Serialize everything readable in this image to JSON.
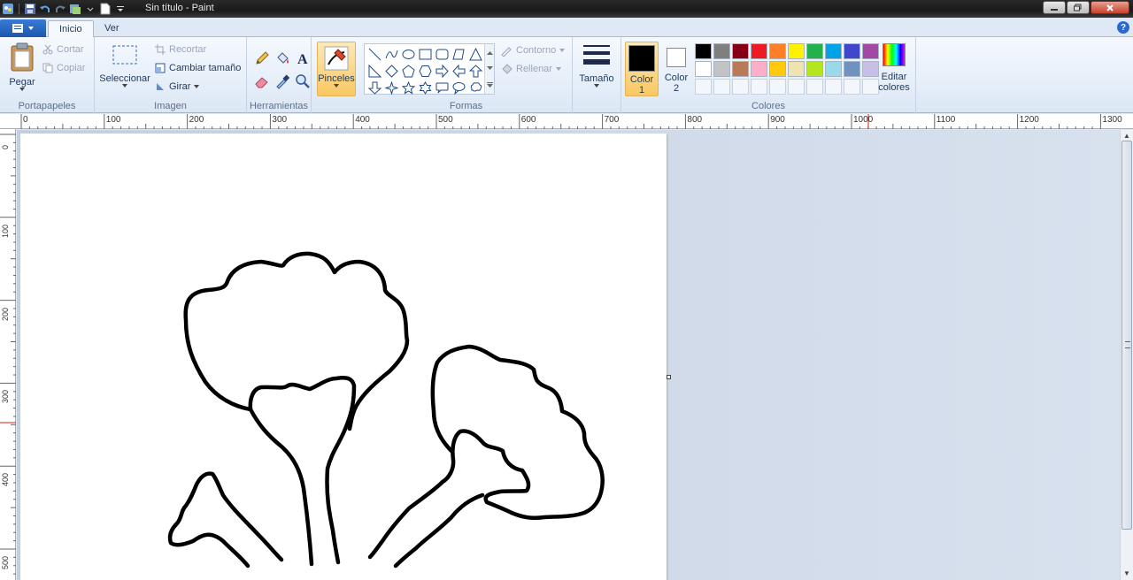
{
  "window": {
    "title": "Sin título - Paint"
  },
  "tabs": [
    {
      "label": "Inicio"
    },
    {
      "label": "Ver"
    }
  ],
  "help": {
    "label": "?"
  },
  "ribbon": {
    "portapapeles": {
      "label": "Portapapeles",
      "pegar": "Pegar",
      "cortar": "Cortar",
      "copiar": "Copiar"
    },
    "imagen": {
      "label": "Imagen",
      "seleccionar": "Seleccionar",
      "recortar": "Recortar",
      "cambiar_tamano": "Cambiar tamaño",
      "girar": "Girar"
    },
    "herramientas": {
      "label": "Herramientas"
    },
    "pinceles": {
      "label": "Pinceles"
    },
    "formas": {
      "label": "Formas",
      "contorno": "Contorno",
      "rellenar": "Rellenar"
    },
    "tamano": {
      "label": "Tamaño"
    },
    "colores": {
      "label": "Colores",
      "color1_line1": "Color",
      "color1_line2": "1",
      "color2_line1": "Color",
      "color2_line2": "2",
      "editar_line1": "Editar",
      "editar_line2": "colores",
      "color1_value": "#000000",
      "color2_value": "#ffffff",
      "palette_row1": [
        "#000000",
        "#7f7f7f",
        "#880015",
        "#ed1c24",
        "#ff7f27",
        "#fff200",
        "#22b14c",
        "#00a2e8",
        "#3f48cc",
        "#a349a4"
      ],
      "palette_row2": [
        "#ffffff",
        "#c3c3c3",
        "#b97a57",
        "#ffaec9",
        "#ffc90e",
        "#efe4b0",
        "#b5e61d",
        "#99d9ea",
        "#7092be",
        "#c8bfe7"
      ]
    }
  },
  "ruler": {
    "h_labels": [
      "0",
      "100",
      "200",
      "300",
      "400",
      "500",
      "600",
      "700",
      "800",
      "900",
      "1000",
      "1100",
      "1200",
      "1300"
    ],
    "v_labels": [
      "0",
      "100",
      "200",
      "300",
      "400",
      "500"
    ]
  },
  "icons": {
    "app_menu": "app-menu-icon",
    "save": "save-icon",
    "undo": "undo-icon",
    "redo": "redo-icon",
    "new": "new-file-icon"
  }
}
